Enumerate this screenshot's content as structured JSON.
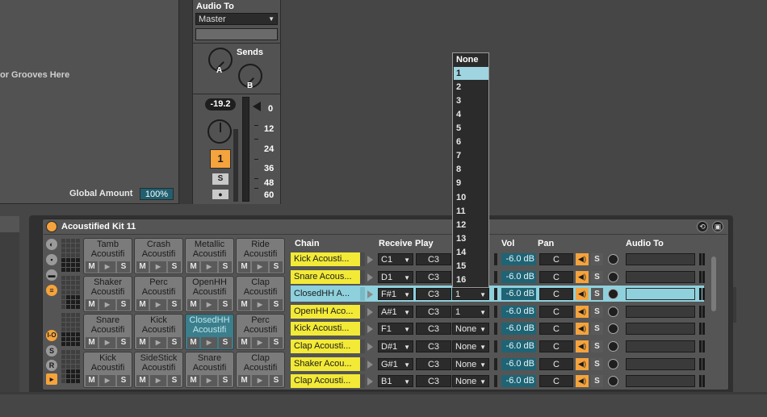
{
  "groove": {
    "hint": "or Grooves Here",
    "global_amount_label": "Global Amount",
    "global_amount_value": "100%"
  },
  "mixer": {
    "audio_to_label": "Audio To",
    "audio_to_value": "Master",
    "sends_label": "Sends",
    "send_a": "A",
    "send_b": "B",
    "volume": "-19.2",
    "track_number": "1",
    "solo": "S",
    "scale": [
      "0",
      "12",
      "24",
      "36",
      "48",
      "60"
    ]
  },
  "rack": {
    "title": "Acoustified Kit 11",
    "headers": {
      "chain": "Chain",
      "receive": "Receive",
      "play": "Play",
      "vol": "Vol",
      "pan": "Pan",
      "audio_to": "Audio To"
    },
    "pads": [
      {
        "name": "Tamb",
        "sub": "Acoustifi"
      },
      {
        "name": "Crash",
        "sub": "Acoustifi"
      },
      {
        "name": "Metallic",
        "sub": "Acoustifi"
      },
      {
        "name": "Ride",
        "sub": "Acoustifi"
      },
      {
        "name": "Shaker",
        "sub": "Acoustifi"
      },
      {
        "name": "Perc",
        "sub": "Acoustifi"
      },
      {
        "name": "OpenHH",
        "sub": "Acoustifi"
      },
      {
        "name": "Clap",
        "sub": "Acoustifi"
      },
      {
        "name": "Snare",
        "sub": "Acoustifi"
      },
      {
        "name": "Kick",
        "sub": "Acoustifi"
      },
      {
        "name": "ClosedHH",
        "sub": "Acoustifi"
      },
      {
        "name": "Perc",
        "sub": "Acoustifi"
      },
      {
        "name": "Kick",
        "sub": "Acoustifi"
      },
      {
        "name": "SideStick",
        "sub": "Acoustifi"
      },
      {
        "name": "Snare",
        "sub": "Acoustifi"
      },
      {
        "name": "Clap",
        "sub": "Acoustifi"
      }
    ],
    "pad_buttons": {
      "mute": "M",
      "play": "▶",
      "solo": "S"
    },
    "side_buttons": [
      "I-O",
      "S",
      "R"
    ],
    "chains": [
      {
        "name": "Kick Acousti...",
        "receive": "C1",
        "play": "C3",
        "choke": "",
        "vol": "-6.0 dB",
        "pan": "C"
      },
      {
        "name": "Snare Acous...",
        "receive": "D1",
        "play": "C3",
        "choke": "",
        "vol": "-6.0 dB",
        "pan": "C"
      },
      {
        "name": "ClosedHH A...",
        "receive": "F#1",
        "play": "C3",
        "choke": "1",
        "vol": "-6.0 dB",
        "pan": "C"
      },
      {
        "name": "OpenHH Aco...",
        "receive": "A#1",
        "play": "C3",
        "choke": "1",
        "vol": "-6.0 dB",
        "pan": "C"
      },
      {
        "name": "Kick Acousti...",
        "receive": "F1",
        "play": "C3",
        "choke": "None",
        "vol": "-6.0 dB",
        "pan": "C"
      },
      {
        "name": "Clap Acousti...",
        "receive": "D#1",
        "play": "C3",
        "choke": "None",
        "vol": "-6.0 dB",
        "pan": "C"
      },
      {
        "name": "Shaker Acou...",
        "receive": "G#1",
        "play": "C3",
        "choke": "None",
        "vol": "-6.0 dB",
        "pan": "C"
      },
      {
        "name": "Clap Acousti...",
        "receive": "B1",
        "play": "C3",
        "choke": "None",
        "vol": "-6.0 dB",
        "pan": "C"
      }
    ],
    "solo_label": "S"
  },
  "choke_menu": {
    "items": [
      "None",
      "1",
      "2",
      "3",
      "4",
      "5",
      "6",
      "7",
      "8",
      "9",
      "10",
      "11",
      "12",
      "13",
      "14",
      "15",
      "16"
    ],
    "selected": "1"
  },
  "colors": {
    "accent_orange": "#f5a33c",
    "chain_yellow": "#f3ea37",
    "selected_blue": "#8fd0dd",
    "vol_teal": "#1f6475"
  }
}
